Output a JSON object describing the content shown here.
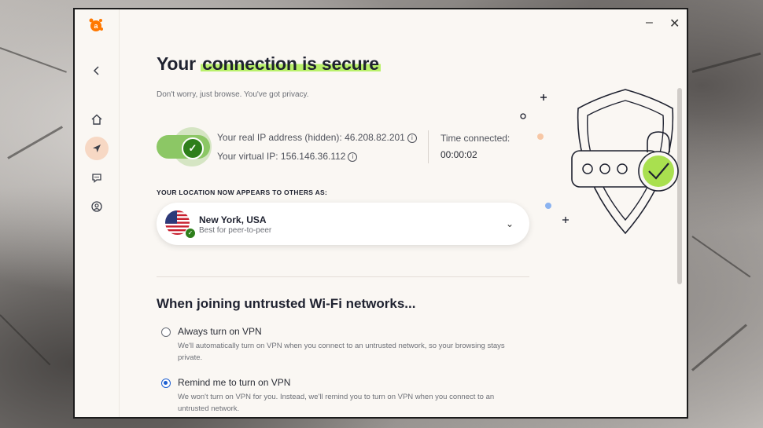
{
  "window": {
    "minimize_label": "–",
    "close_label": "✕"
  },
  "sidebar": {
    "items": [
      {
        "name": "back",
        "icon": "chevron-left-icon"
      },
      {
        "name": "home",
        "icon": "home-icon"
      },
      {
        "name": "location",
        "icon": "navigation-arrow-icon",
        "active": true
      },
      {
        "name": "chat",
        "icon": "chat-bubble-icon"
      },
      {
        "name": "account",
        "icon": "user-circle-icon"
      }
    ]
  },
  "header": {
    "title_prefix": "Your ",
    "title_highlight": "connection is secure",
    "subtitle": "Don't worry, just browse. You've got privacy."
  },
  "status": {
    "toggle_on": true,
    "real_ip_label": "Your real IP address (hidden): 46.208.82.201",
    "virtual_ip_label": "Your virtual IP: 156.146.36.112",
    "time_label": "Time connected:",
    "time_value": "00:00:02"
  },
  "location": {
    "caption": "YOUR LOCATION NOW APPEARS TO OTHERS AS:",
    "name": "New York, USA",
    "sub": "Best for peer-to-peer"
  },
  "wifi": {
    "heading": "When joining untrusted Wi-Fi networks...",
    "options": [
      {
        "label": "Always turn on VPN",
        "desc": "We'll automatically turn on VPN when you connect to an untrusted network, so your browsing stays private.",
        "selected": false
      },
      {
        "label": "Remind me to turn on VPN",
        "desc": "We won't turn on VPN for you. Instead, we'll remind you to turn on VPN when you connect to an untrusted network.",
        "selected": true
      }
    ]
  },
  "colors": {
    "accent_green": "#2e7f1b",
    "highlight": "#b9f06a",
    "brand_orange": "#ff7800",
    "radio_blue": "#1d5fd1"
  }
}
